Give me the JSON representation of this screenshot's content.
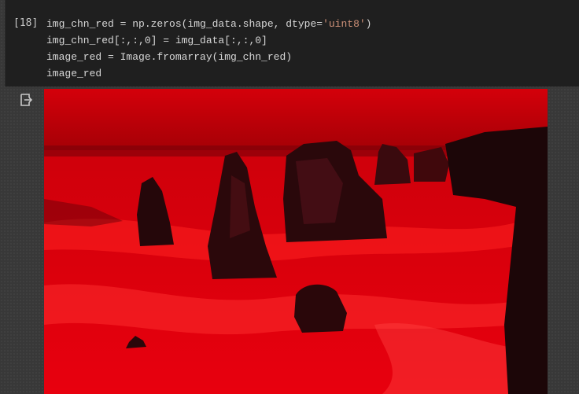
{
  "cell": {
    "execution_count": "[18]",
    "code_lines": [
      "img_chn_red = np.zeros(img_data.shape, dtype='uint8')",
      "img_chn_red[:,:,0] = img_data[:,:,0]",
      "image_red = Image.fromarray(img_chn_red)",
      "image_red"
    ]
  },
  "output": {
    "icon": "output-redirect-icon",
    "image_tint": "#ff0000"
  },
  "colors": {
    "cell_background": "#1f1f1f",
    "page_background": "#383838",
    "string_literal": "#ce9178"
  }
}
